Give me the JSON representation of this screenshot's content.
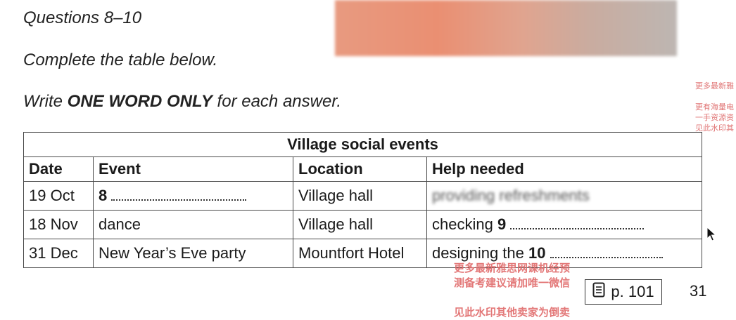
{
  "header": {
    "title": "Questions 8–10",
    "instruction_1": "Complete the table below.",
    "instruction_2_prefix": "Write ",
    "instruction_2_bold": "ONE WORD ONLY",
    "instruction_2_suffix": " for each answer."
  },
  "table": {
    "caption": "Village social events",
    "columns": [
      "Date",
      "Event",
      "Location",
      "Help needed"
    ],
    "rows": [
      {
        "date": "19 Oct",
        "event_qnum": "8",
        "location": "Village hall",
        "help": "providing refreshments"
      },
      {
        "date": "18 Nov",
        "event": "dance",
        "location": "Village hall",
        "help_prefix": "checking ",
        "help_qnum": "9"
      },
      {
        "date": "31 Dec",
        "event": "New Year’s Eve party",
        "location": "Mountfort Hotel",
        "help_prefix": "designing the ",
        "help_qnum": "10"
      }
    ]
  },
  "footer": {
    "page_ref": "p. 101",
    "page_number": "31"
  },
  "watermarks": {
    "right": [
      "更多最新雅",
      "更有海量电",
      "一手资源资",
      "见此水印其"
    ],
    "bottom": [
      "更多最新雅思网课机经预",
      "测备考建议请加唯一微信",
      "见此水印其他卖家为倒卖"
    ]
  },
  "icons": {
    "document": "document-icon",
    "cursor": "mouse-pointer-icon"
  }
}
